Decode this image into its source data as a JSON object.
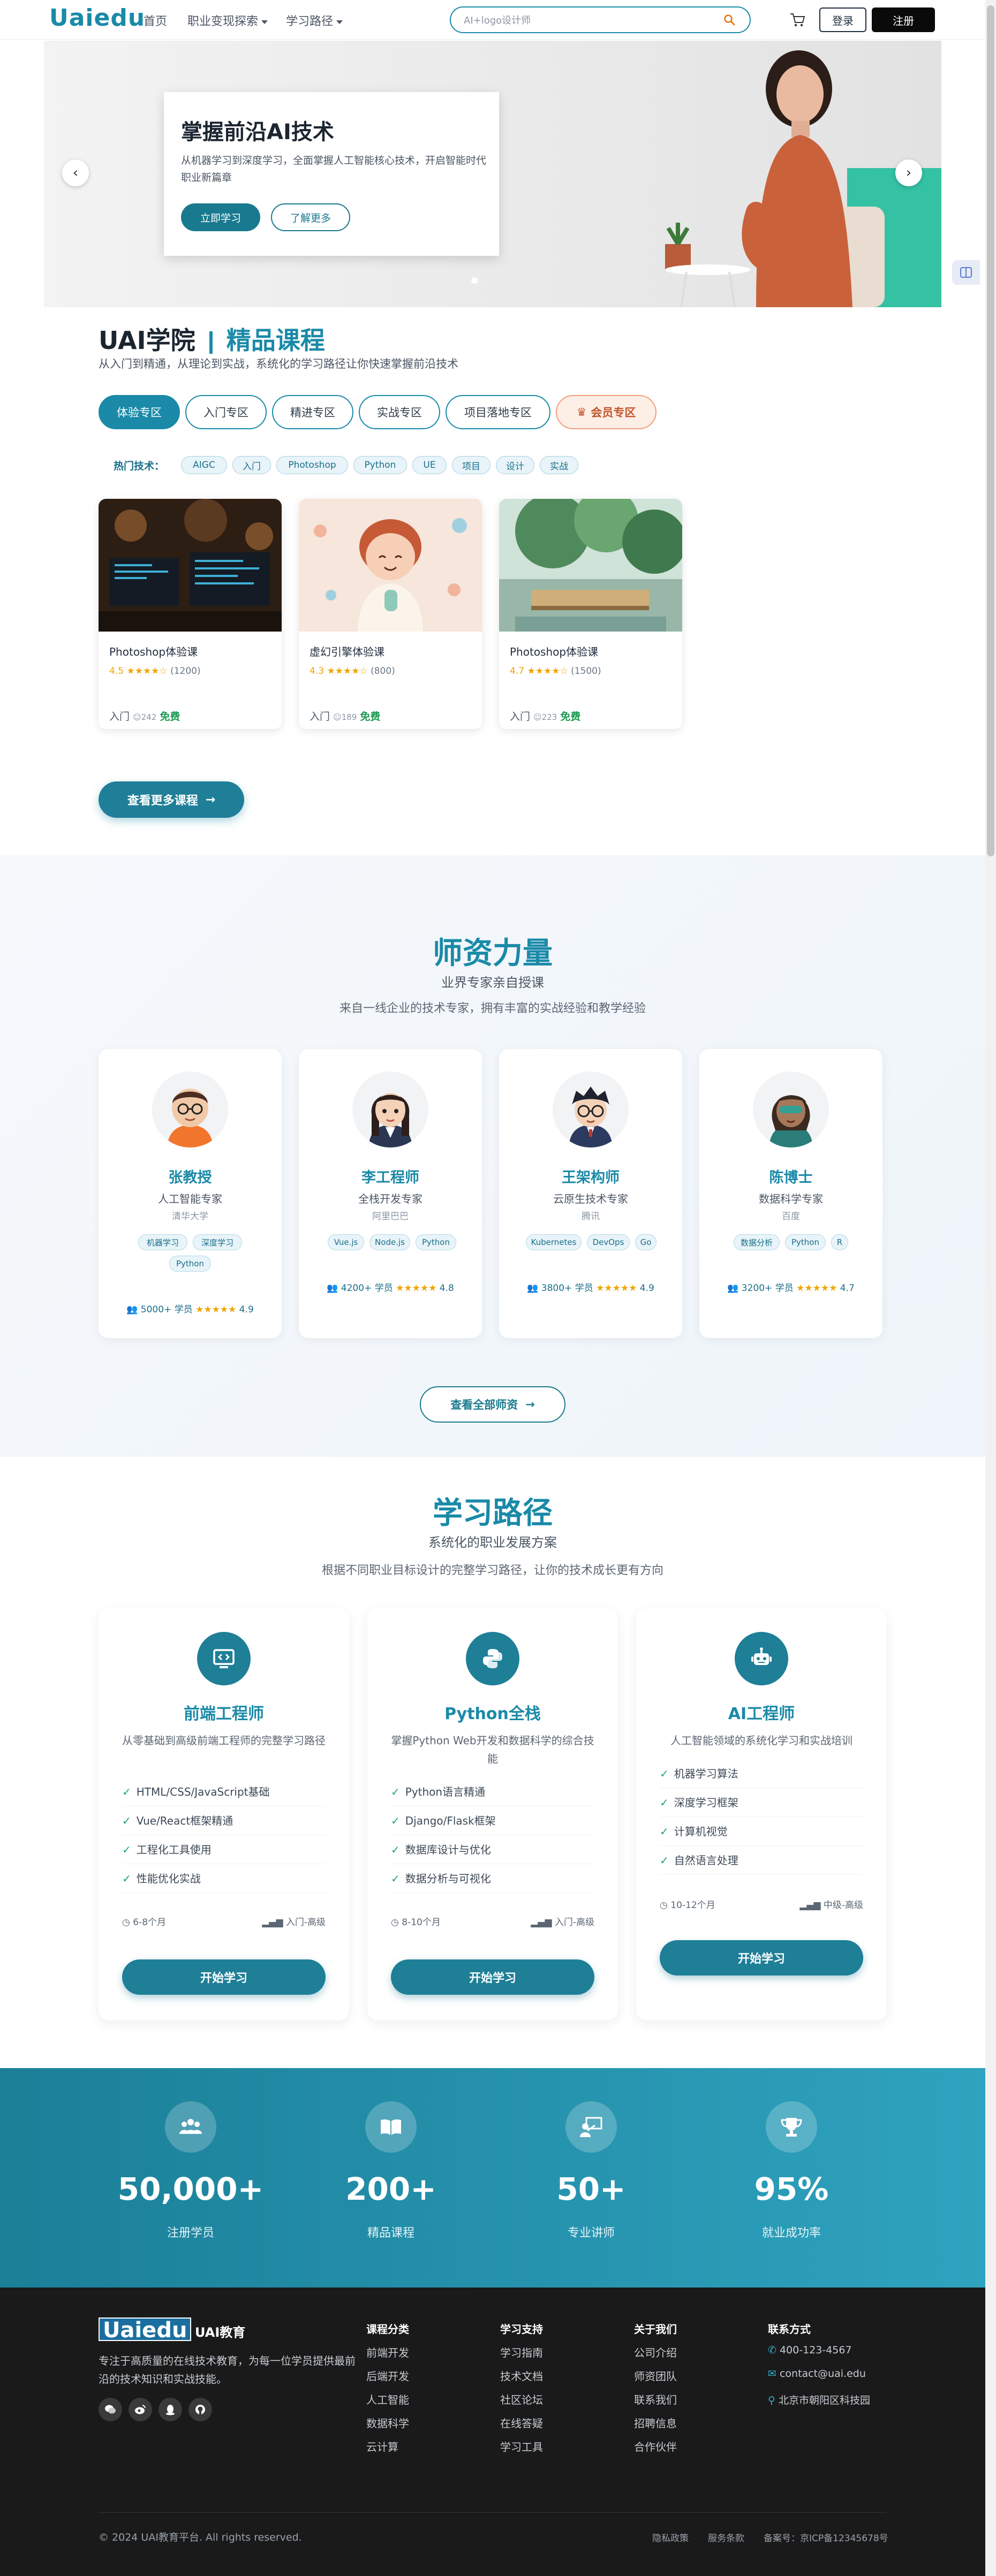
{
  "header": {
    "logo": "Uaiedu",
    "nav": [
      {
        "label": "首页"
      },
      {
        "label": "职业变现探索"
      },
      {
        "label": "学习路径"
      }
    ],
    "search_placeholder": "AI+logo设计师",
    "login": "登录",
    "register": "注册"
  },
  "hero": {
    "title": "掌握前沿AI技术",
    "desc": "从机器学习到深度学习，全面掌握人工智能核心技术，开启智能时代职业新篇章",
    "primary_btn": "立即学习",
    "secondary_btn": "了解更多",
    "prev": "‹",
    "next": "›"
  },
  "courses_section": {
    "title_prefix": "UAI学院",
    "title_highlight": "精品课程",
    "subtitle": "从入门到精通，从理论到实战，系统化的学习路径让你快速掌握前沿技术",
    "tabs": [
      "体验专区",
      "入门专区",
      "精进专区",
      "实战专区",
      "项目落地专区",
      "会员专区"
    ],
    "hot_label": "热门技术：",
    "hot_tags": [
      "AIGC",
      "入门",
      "Photoshop",
      "Python",
      "UE",
      "项目",
      "设计",
      "实战"
    ],
    "courses": [
      {
        "name": "Photoshop体验课",
        "rating": "4.5",
        "stars": "★★★★☆",
        "count": "(1200)",
        "level": "入门",
        "students": "242",
        "price": "免费"
      },
      {
        "name": "虚幻引擎体验课",
        "rating": "4.3",
        "stars": "★★★★☆",
        "count": "(800)",
        "level": "入门",
        "students": "189",
        "price": "免费"
      },
      {
        "name": "Photoshop体验课",
        "rating": "4.7",
        "stars": "★★★★☆",
        "count": "(1500)",
        "level": "入门",
        "students": "223",
        "price": "免费"
      }
    ],
    "more_btn": "查看更多课程"
  },
  "teachers_section": {
    "title": "师资力量",
    "subtitle": "业界专家亲自授课",
    "desc": "来自一线企业的技术专家，拥有丰富的实战经验和教学经验",
    "teachers": [
      {
        "name": "张教授",
        "role": "人工智能专家",
        "org": "清华大学",
        "tags": [
          "机器学习",
          "深度学习",
          "Python"
        ],
        "students": "5000+ 学员",
        "stars": "★★★★★",
        "rating": "4.9"
      },
      {
        "name": "李工程师",
        "role": "全栈开发专家",
        "org": "阿里巴巴",
        "tags": [
          "Vue.js",
          "Node.js",
          "Python"
        ],
        "students": "4200+ 学员",
        "stars": "★★★★★",
        "rating": "4.8"
      },
      {
        "name": "王架构师",
        "role": "云原生技术专家",
        "org": "腾讯",
        "tags": [
          "Kubernetes",
          "DevOps",
          "Go"
        ],
        "students": "3800+ 学员",
        "stars": "★★★★★",
        "rating": "4.9"
      },
      {
        "name": "陈博士",
        "role": "数据科学专家",
        "org": "百度",
        "tags": [
          "数据分析",
          "Python",
          "R"
        ],
        "students": "3200+ 学员",
        "stars": "★★★★★",
        "rating": "4.7"
      }
    ],
    "all_btn": "查看全部师资"
  },
  "paths_section": {
    "title": "学习路径",
    "subtitle": "系统化的职业发展方案",
    "desc": "根据不同职业目标设计的完整学习路径，让你的技术成长更有方向",
    "paths": [
      {
        "title": "前端工程师",
        "desc": "从零基础到高级前端工程师的完整学习路径",
        "items": [
          "HTML/CSS/JavaScript基础",
          "Vue/React框架精通",
          "工程化工具使用",
          "性能优化实战"
        ],
        "duration": "6-8个月",
        "level": "入门-高级",
        "btn": "开始学习"
      },
      {
        "title": "Python全栈",
        "desc": "掌握Python Web开发和数据科学的综合技能",
        "items": [
          "Python语言精通",
          "Django/Flask框架",
          "数据库设计与优化",
          "数据分析与可视化"
        ],
        "duration": "8-10个月",
        "level": "入门-高级",
        "btn": "开始学习"
      },
      {
        "title": "AI工程师",
        "desc": "人工智能领域的系统化学习和实战培训",
        "items": [
          "机器学习算法",
          "深度学习框架",
          "计算机视觉",
          "自然语言处理"
        ],
        "duration": "10-12个月",
        "level": "中级-高级",
        "btn": "开始学习"
      }
    ]
  },
  "stats": [
    {
      "value": "50,000+",
      "label": "注册学员",
      "icon": "users-icon"
    },
    {
      "value": "200+",
      "label": "精品课程",
      "icon": "book-icon"
    },
    {
      "value": "50+",
      "label": "专业讲师",
      "icon": "teacher-icon"
    },
    {
      "value": "95%",
      "label": "就业成功率",
      "icon": "trophy-icon"
    }
  ],
  "footer": {
    "logo": "Uaiedu",
    "brand": "UAI教育",
    "desc": "专注于高质量的在线技术教育，为每一位学员提供最前沿的技术知识和实战技能。",
    "columns": [
      {
        "title": "课程分类",
        "items": [
          "前端开发",
          "后端开发",
          "人工智能",
          "数据科学",
          "云计算"
        ]
      },
      {
        "title": "学习支持",
        "items": [
          "学习指南",
          "技术文档",
          "社区论坛",
          "在线答疑",
          "学习工具"
        ]
      },
      {
        "title": "关于我们",
        "items": [
          "公司介绍",
          "师资团队",
          "联系我们",
          "招聘信息",
          "合作伙伴"
        ]
      }
    ],
    "contact_title": "联系方式",
    "phone": "400-123-4567",
    "email": "contact@uai.edu",
    "address": "北京市朝阳区科技园",
    "copyright": "© 2024 UAI教育平台. All rights reserved.",
    "links": [
      "隐私政策",
      "服务条款",
      "备案号：京ICP备12345678号"
    ]
  },
  "colors": {
    "primary": "#1a8aa8",
    "dark": "#1e7f97",
    "footer": "#1a1a1a"
  }
}
